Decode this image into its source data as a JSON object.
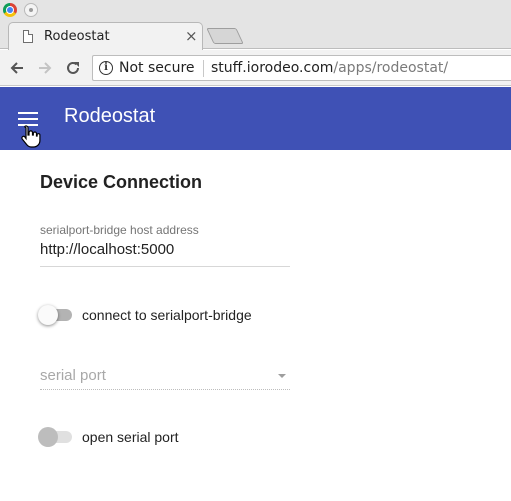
{
  "browser": {
    "tab_title": "Rodeostat",
    "tab_close": "×",
    "security_label": "Not secure",
    "url_host": "stuff.iorodeo.com",
    "url_path": "/apps/rodeostat/"
  },
  "appbar": {
    "title": "Rodeostat",
    "color": "#3f51b5"
  },
  "device_connection": {
    "heading": "Device Connection",
    "host_field": {
      "label": "serialport-bridge host address",
      "value": "http://localhost:5000"
    },
    "connect_switch": {
      "label": "connect to serialport-bridge",
      "on": false,
      "enabled": true
    },
    "serial_port_select": {
      "placeholder": "serial port",
      "enabled": false
    },
    "open_port_switch": {
      "label": "open serial port",
      "on": false,
      "enabled": false
    }
  }
}
